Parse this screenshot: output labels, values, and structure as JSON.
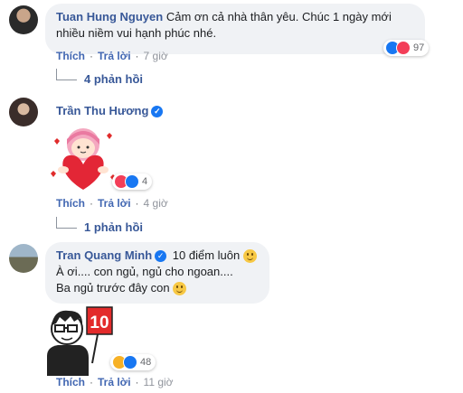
{
  "comments": [
    {
      "author": "Tuan Hung Nguyen",
      "text": "Cảm ơn cả nhà thân yêu. Chúc 1 ngày mới nhiều niềm vui hạnh phúc nhé.",
      "like_label": "Thích",
      "reply_label": "Trả lời",
      "time": "7 giờ",
      "reaction_count": "97",
      "reactions": [
        "like-icon",
        "love-icon"
      ],
      "replies_label": "4 phản hồi"
    },
    {
      "author": "Trần Thu Hương",
      "verified": true,
      "sticker": "girl-hugging-heart-sticker",
      "like_label": "Thích",
      "reply_label": "Trả lời",
      "time": "4 giờ",
      "reaction_count": "4",
      "reactions": [
        "love-icon",
        "like-icon"
      ],
      "replies_label": "1 phản hồi"
    },
    {
      "author": "Tran Quang Minh",
      "verified": true,
      "inline_text": "10 điểm luôn",
      "line1": "À ơi.... con ngủ, ngủ cho ngoan....",
      "line2": "Ba ngủ trước đây con",
      "sticker": "man-holding-10-sign-sticker",
      "sticker_sign": "10",
      "like_label": "Thích",
      "reply_label": "Trả lời",
      "time": "11 giờ",
      "reaction_count": "48",
      "reactions": [
        "haha-icon",
        "like-icon"
      ]
    }
  ],
  "colors": {
    "like": "#1877f2",
    "love": "#f33e58",
    "haha": "#f7b125",
    "name": "#385898",
    "bubble": "#f0f2f5"
  }
}
